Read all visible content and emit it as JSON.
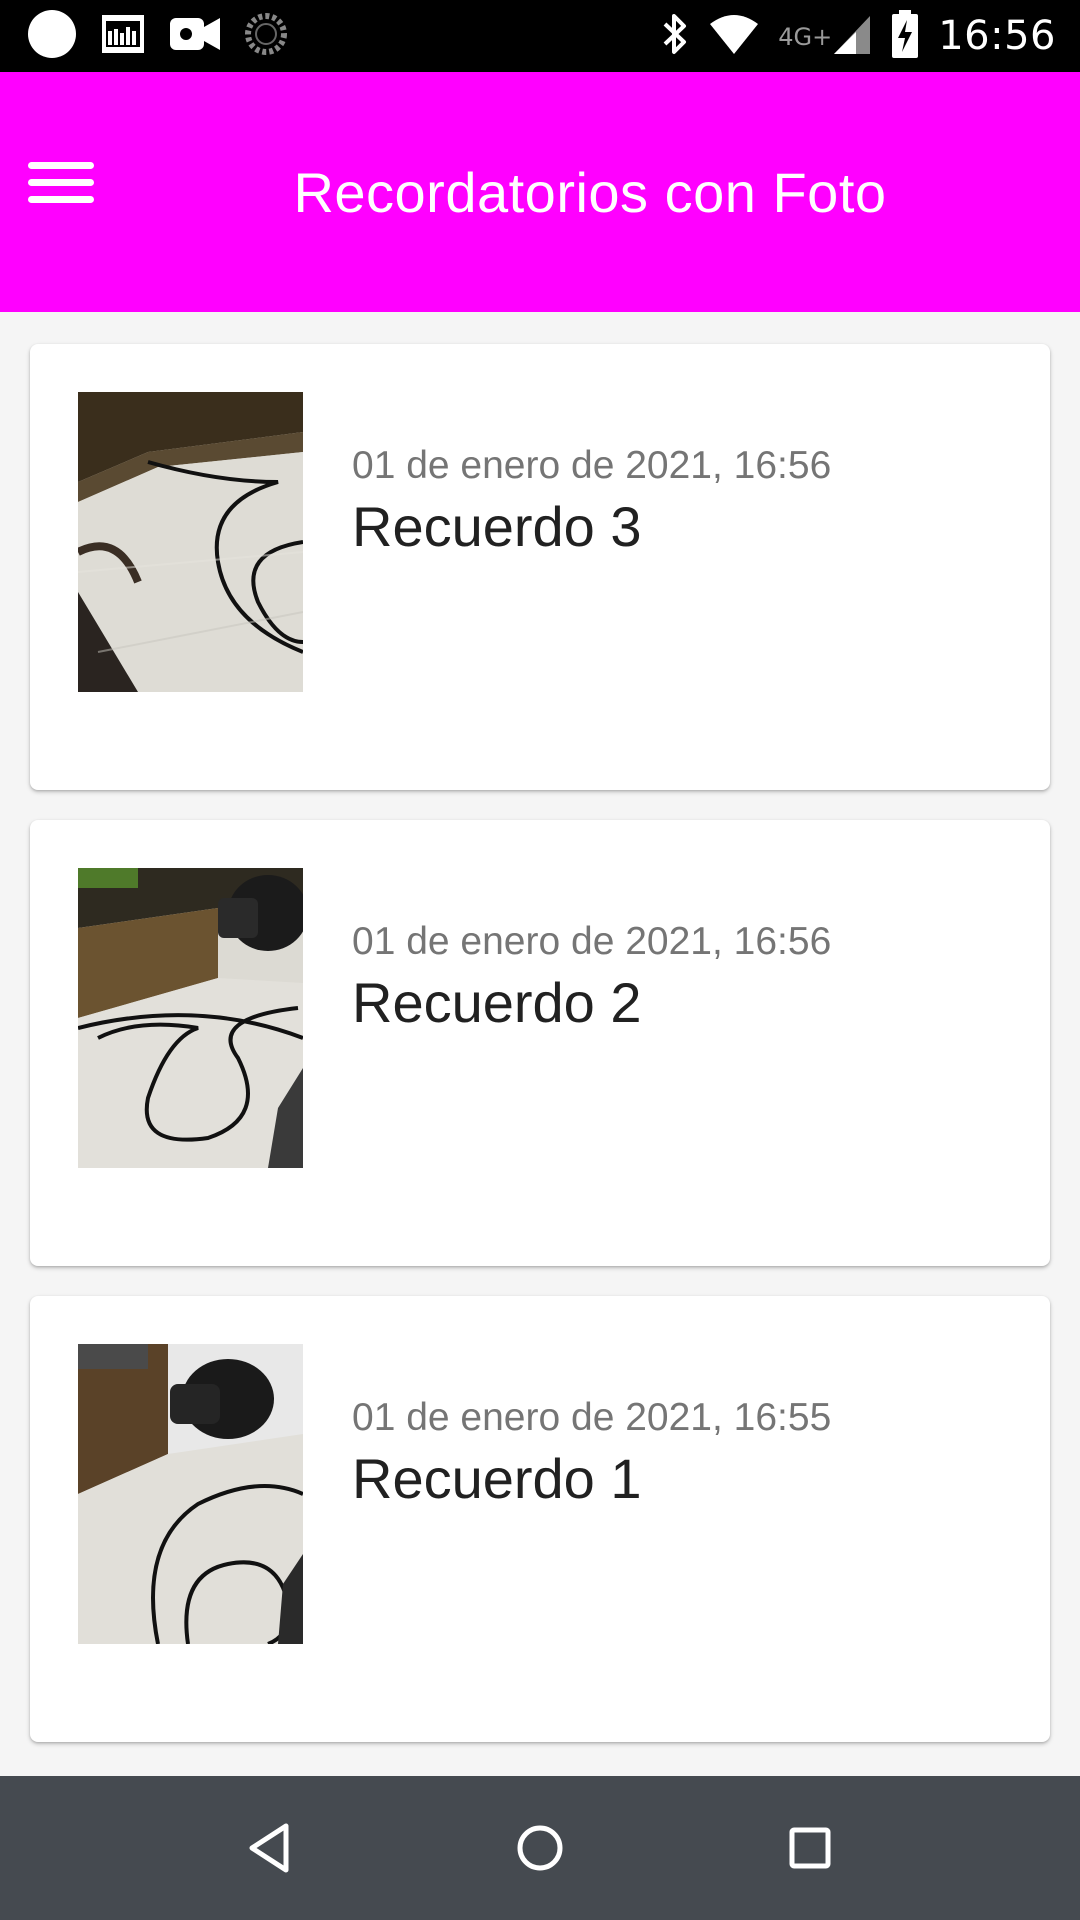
{
  "status_bar": {
    "time": "16:56",
    "network": "4G+",
    "left_icons": [
      "circle-notification-icon",
      "gallery-notification-icon",
      "video-camera-icon",
      "loading-spinner-icon"
    ],
    "right_icons": [
      "bluetooth-icon",
      "wifi-icon",
      "signal-icon",
      "battery-charging-icon"
    ]
  },
  "app_bar": {
    "title": "Recordatorios con Foto",
    "background": "#ff00ff",
    "menu_icon": "menu-icon"
  },
  "reminders": [
    {
      "date": "01 de enero de 2021, 16:56",
      "title": "Recuerdo 3",
      "thumbnail": "photo-cable-on-desk"
    },
    {
      "date": "01 de enero de 2021, 16:56",
      "title": "Recuerdo 2",
      "thumbnail": "photo-cable-with-lamp"
    },
    {
      "date": "01 de enero de 2021, 16:55",
      "title": "Recuerdo 1",
      "thumbnail": "photo-lamp-and-cable"
    }
  ],
  "nav_bar": {
    "icons": [
      "back-icon",
      "home-icon",
      "recents-icon"
    ],
    "background": "#454a50"
  }
}
